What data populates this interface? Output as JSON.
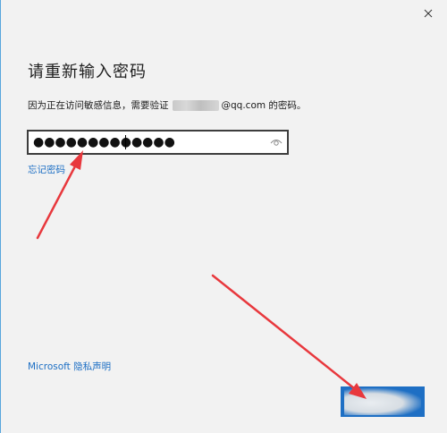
{
  "window": {
    "close_icon": "close-icon"
  },
  "dialog": {
    "title": "请重新输入密码",
    "description_prefix": "因为正在访问敏感信息，需要验证",
    "description_suffix": "@qq.com 的密码。",
    "password_value": "●●●●●●●●●●●●●",
    "reveal_icon": "eye-icon",
    "forgot_link": "忘记密码",
    "privacy_link": "Microsoft 隐私声明"
  },
  "colors": {
    "background": "#f2f2f2",
    "link": "#1d6fc4",
    "button": "#1e6fc4",
    "annotation_arrow": "#e8383d"
  }
}
